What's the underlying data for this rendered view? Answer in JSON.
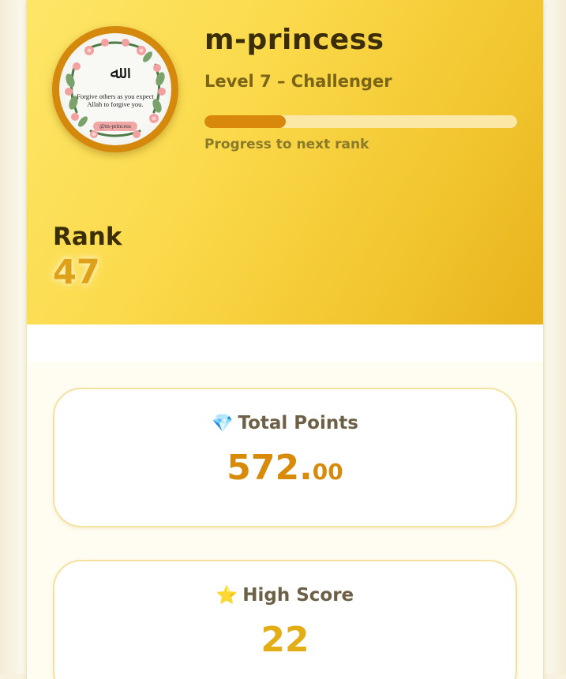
{
  "profile": {
    "username": "m-princess",
    "level": "Level 7 – Challenger",
    "progress_label": "Progress to next rank",
    "progress_fraction": 0.26,
    "avatar": {
      "arabic_text": "ﷲ",
      "quote": "Forgive others as you expect Allah to forgive you.",
      "handle": "@m-princess"
    }
  },
  "rank": {
    "label": "Rank",
    "value": "47"
  },
  "stats": {
    "total_points": {
      "icon": "💎",
      "icon_name": "gem-icon",
      "label": "Total Points",
      "integer": "572.",
      "decimals": "00"
    },
    "high_score": {
      "icon": "⭐",
      "icon_name": "star-icon",
      "label": "High Score",
      "value": "22"
    }
  },
  "colors": {
    "header_gradient_start": "#fde668",
    "header_gradient_end": "#e8b21c",
    "accent_orange": "#d88b0b",
    "rank_gold": "#e0a11a",
    "progress_track": "#fbe7a6",
    "avatar_ring": "#d4880c"
  }
}
